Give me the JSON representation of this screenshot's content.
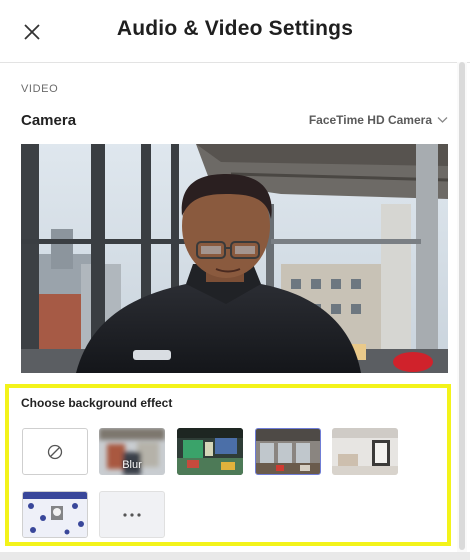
{
  "dialog": {
    "title": "Audio & Video Settings"
  },
  "video": {
    "section_label": "VIDEO",
    "camera_label": "Camera",
    "camera_value": "FaceTime HD Camera"
  },
  "effects": {
    "title": "Choose background effect",
    "tiles": [
      {
        "name": "none",
        "label": ""
      },
      {
        "name": "blur",
        "label": "Blur"
      },
      {
        "name": "green-office",
        "label": ""
      },
      {
        "name": "industrial-loft",
        "label": ""
      },
      {
        "name": "white-room",
        "label": ""
      },
      {
        "name": "snowflake-pattern",
        "label": ""
      },
      {
        "name": "more",
        "label": ""
      }
    ]
  },
  "icons": {
    "close": "close-icon",
    "chevron": "chevron-down-icon",
    "none": "no-effect-icon",
    "more": "more-icon"
  },
  "colors": {
    "highlight": "#f3f31a",
    "selected_border": "#6f7dd6"
  }
}
